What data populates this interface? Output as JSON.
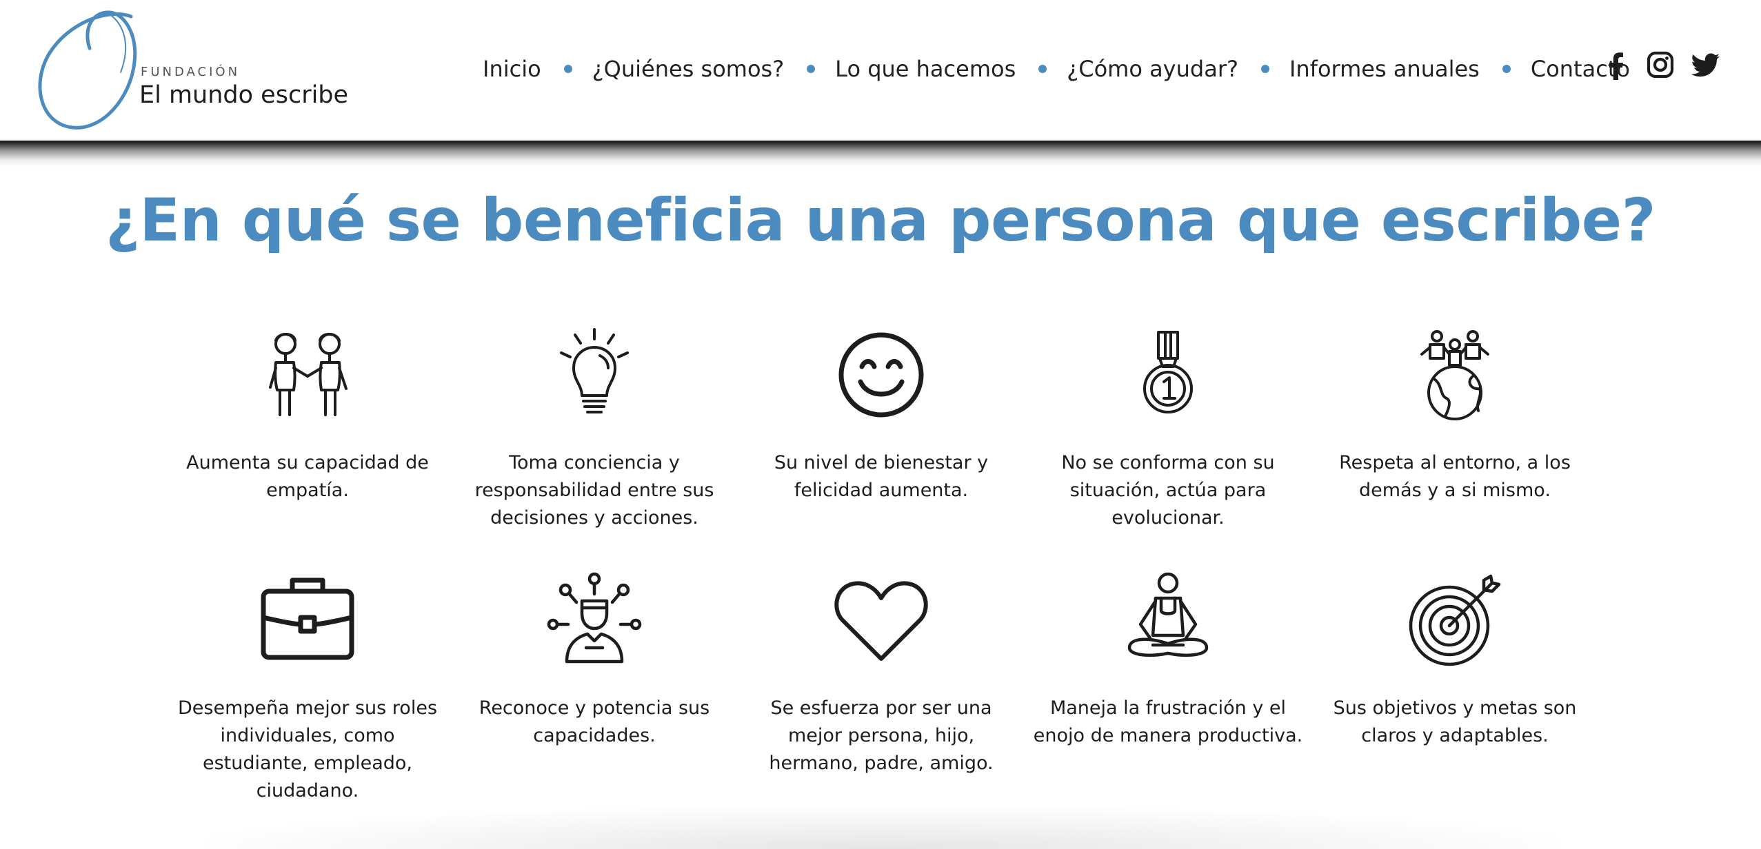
{
  "brand": {
    "subtitle": "FUNDACIÓN",
    "title": "El mundo escribe",
    "accent_color": "#4b8bbf"
  },
  "nav": {
    "items": [
      {
        "label": "Inicio"
      },
      {
        "label": "¿Quiénes somos?"
      },
      {
        "label": "Lo que hacemos"
      },
      {
        "label": "¿Cómo ayudar?"
      },
      {
        "label": "Informes anuales"
      },
      {
        "label": "Contacto"
      }
    ]
  },
  "social": [
    {
      "icon": "facebook-icon"
    },
    {
      "icon": "instagram-icon"
    },
    {
      "icon": "twitter-icon"
    }
  ],
  "section": {
    "heading": "¿En qué se beneficia una persona que escribe?"
  },
  "benefits": [
    {
      "icon": "handshake-people-icon",
      "text": "Aumenta su capacidad de empatía."
    },
    {
      "icon": "lightbulb-icon",
      "text": "Toma conciencia y responsabilidad entre sus decisiones y acciones."
    },
    {
      "icon": "smiley-face-icon",
      "text": "Su nivel de bienestar y felicidad aumenta."
    },
    {
      "icon": "medal-icon",
      "text": "No se conforma con su situación, actúa para evolucionar."
    },
    {
      "icon": "people-on-globe-icon",
      "text": "Respeta al entorno, a los demás y a si mismo."
    },
    {
      "icon": "briefcase-icon",
      "text": "Desempeña mejor sus roles individuales, como estudiante, empleado, ciudadano."
    },
    {
      "icon": "person-skills-network-icon",
      "text": "Reconoce y potencia sus capacidades."
    },
    {
      "icon": "heart-icon",
      "text": "Se esfuerza por ser una mejor persona, hijo, hermano, padre, amigo."
    },
    {
      "icon": "meditation-icon",
      "text": "Maneja la frustración y el enojo de manera productiva."
    },
    {
      "icon": "target-arrow-icon",
      "text": "Sus objetivos y metas son claros y adaptables."
    }
  ]
}
